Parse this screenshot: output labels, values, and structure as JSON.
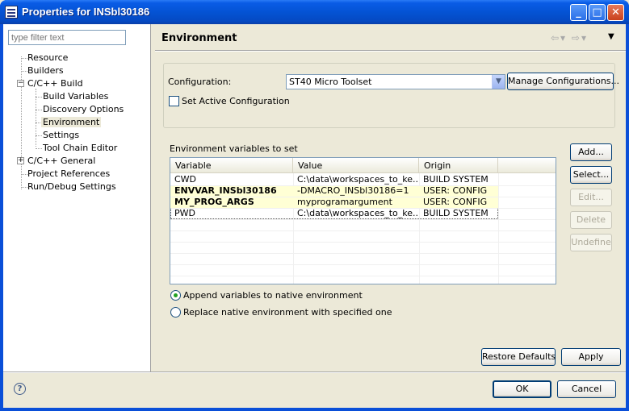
{
  "window": {
    "title": "Properties for INSbl30186"
  },
  "filter": {
    "placeholder": "type filter text"
  },
  "tree": {
    "resource": "Resource",
    "builders": "Builders",
    "cpp_build": "C/C++ Build",
    "build_variables": "Build Variables",
    "discovery_options": "Discovery Options",
    "environment": "Environment",
    "settings": "Settings",
    "tool_chain_editor": "Tool Chain Editor",
    "cpp_general": "C/C++ General",
    "project_references": "Project References",
    "run_debug_settings": "Run/Debug Settings"
  },
  "page": {
    "title": "Environment"
  },
  "config": {
    "label": "Configuration:",
    "value": "ST40 Micro Toolset",
    "manage_label": "Manage Configurations...",
    "set_active_label": "Set Active Configuration"
  },
  "env": {
    "section_label": "Environment variables to set",
    "columns": [
      "Variable",
      "Value",
      "Origin"
    ],
    "rows": [
      {
        "variable": "CWD",
        "value": "C:\\data\\workspaces_to_ke...",
        "origin": "BUILD SYSTEM"
      },
      {
        "variable": "ENVVAR_INSbl30186",
        "value": "-DMACRO_INSbl30186=1",
        "origin": "USER: CONFIG"
      },
      {
        "variable": "MY_PROG_ARGS",
        "value": "myprogramargument",
        "origin": "USER: CONFIG"
      },
      {
        "variable": "PWD",
        "value": "C:\\data\\workspaces_to_ke...",
        "origin": "BUILD SYSTEM"
      }
    ]
  },
  "buttons": {
    "add": "Add...",
    "select": "Select...",
    "edit": "Edit...",
    "delete": "Delete",
    "undefine": "Undefine",
    "restore_defaults": "Restore Defaults",
    "apply": "Apply",
    "ok": "OK",
    "cancel": "Cancel"
  },
  "options": {
    "append": "Append variables to native environment",
    "replace": "Replace native environment with specified one"
  },
  "colors": {
    "title_bar": "#0453d4",
    "highlight_row": "#ffffd5",
    "radio_dot": "#21a121"
  }
}
